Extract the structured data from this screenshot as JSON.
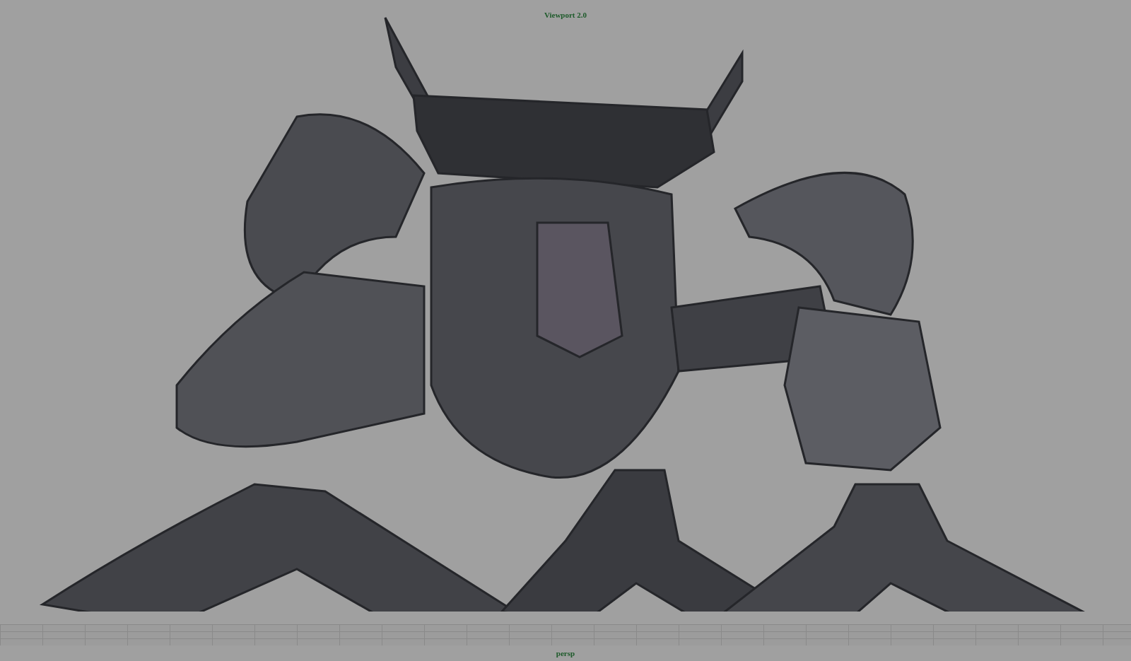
{
  "viewport": {
    "renderer_label": "Viewport 2.0",
    "camera_label": "persp"
  }
}
